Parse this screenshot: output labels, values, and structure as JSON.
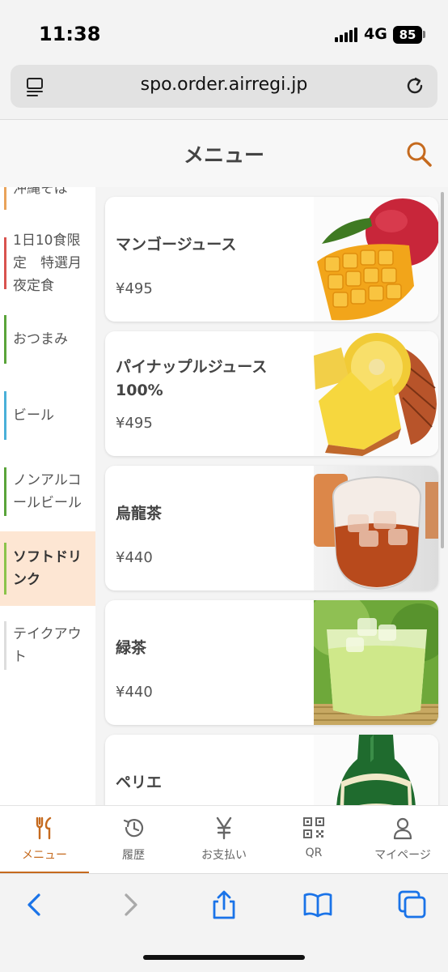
{
  "status": {
    "time": "11:38",
    "network": "4G",
    "battery": "85"
  },
  "browser": {
    "url": "spo.order.airregi.jp"
  },
  "header": {
    "title": "メニュー"
  },
  "categories": [
    {
      "label": "沖縄そば",
      "color": "#e9a35a",
      "selected": false
    },
    {
      "label": "1日10食限定　特選月夜定食",
      "color": "#d9534f",
      "selected": false
    },
    {
      "label": "おつまみ",
      "color": "#5aa43a",
      "selected": false
    },
    {
      "label": "ビール",
      "color": "#4ab0d9",
      "selected": false
    },
    {
      "label": "ノンアルコールビール",
      "color": "#5aa43a",
      "selected": false
    },
    {
      "label": "ソフトドリンク",
      "color": "#8bc34a",
      "selected": true
    },
    {
      "label": "テイクアウト",
      "color": "#dddddd",
      "selected": false
    }
  ],
  "items": [
    {
      "name": "マンゴージュース",
      "price": "¥495",
      "image": "mango-image"
    },
    {
      "name": "パイナップルジュース100%",
      "price": "¥495",
      "image": "pineapple-image"
    },
    {
      "name": "烏龍茶",
      "price": "¥440",
      "image": "oolong-tea-image"
    },
    {
      "name": "緑茶",
      "price": "¥440",
      "image": "green-tea-image"
    },
    {
      "name": "ペリエ",
      "price": "",
      "image": "perrier-image"
    }
  ],
  "bottom_nav": [
    {
      "label": "メニュー",
      "icon": "fork-knife-icon",
      "active": true
    },
    {
      "label": "履歴",
      "icon": "history-icon",
      "active": false
    },
    {
      "label": "お支払い",
      "icon": "yen-icon",
      "active": false
    },
    {
      "label": "QR",
      "icon": "qr-code-icon",
      "active": false
    },
    {
      "label": "マイページ",
      "icon": "person-icon",
      "active": false
    }
  ],
  "colors": {
    "accent": "#c56a1e",
    "selected_category_bg": "#fde6d3"
  }
}
